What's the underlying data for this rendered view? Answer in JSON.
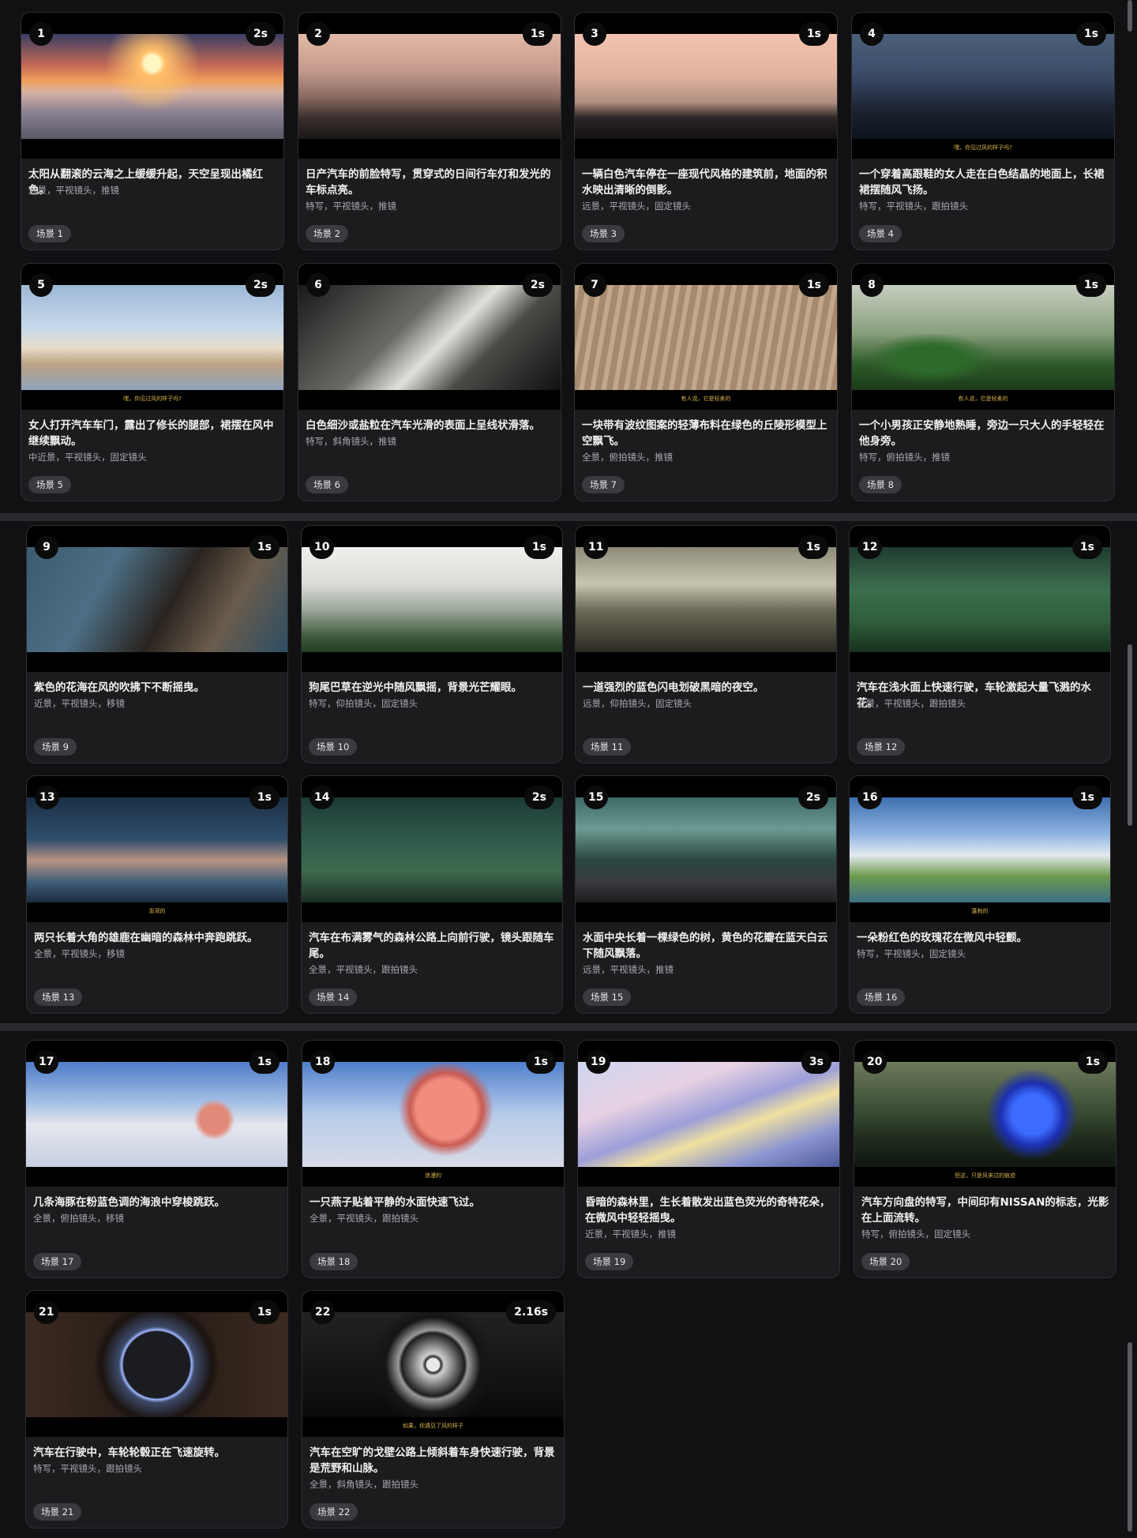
{
  "scene_prefix": "场景",
  "scenes": [
    {
      "n": "1",
      "dur": "2s",
      "desc": "太阳从翻滚的云海之上缓缓升起，天空呈现出橘红色。",
      "tags": "远景，平视镜头，推镜",
      "badge": "场景 1",
      "sub": "",
      "art": "sunrise"
    },
    {
      "n": "2",
      "dur": "1s",
      "desc": "日产汽车的前脸特写，贯穿式的日间行车灯和发光的车标点亮。",
      "tags": "特写，平视镜头，推镜",
      "badge": "场景 2",
      "sub": "",
      "art": "hood"
    },
    {
      "n": "3",
      "dur": "1s",
      "desc": "一辆白色汽车停在一座现代风格的建筑前，地面的积水映出清晰的倒影。",
      "tags": "远景，平视镜头，固定镜头",
      "badge": "场景 3",
      "sub": "",
      "art": "carfront"
    },
    {
      "n": "4",
      "dur": "1s",
      "desc": "一个穿着高跟鞋的女人走在白色结晶的地面上，长裙裙摆随风飞扬。",
      "tags": "特写，平视镜头，跟拍镜头",
      "badge": "场景 4",
      "sub": "嘿，你见过风的样子吗?",
      "art": "building"
    },
    {
      "n": "5",
      "dur": "2s",
      "desc": "女人打开汽车车门，露出了修长的腿部，裙摆在风中继续飘动。",
      "tags": "中近景，平视镜头，固定镜头",
      "badge": "场景 5",
      "sub": "嘿，你见过风的样子吗?",
      "art": "dress"
    },
    {
      "n": "6",
      "dur": "2s",
      "desc": "白色细沙或盐粒在汽车光滑的表面上呈线状滑落。",
      "tags": "特写，斜角镜头，推镜",
      "badge": "场景 6",
      "sub": "",
      "art": "sand"
    },
    {
      "n": "7",
      "dur": "1s",
      "desc": "一块带有波纹图案的轻薄布料在绿色的丘陵形模型上空飘飞。",
      "tags": "全景，俯拍镜头，推镜",
      "badge": "场景 7",
      "sub": "有人说，它是轻柔的",
      "art": "stripes"
    },
    {
      "n": "8",
      "dur": "1s",
      "desc": "一个小男孩正安静地熟睡，旁边一只大人的手轻轻在他身旁。",
      "tags": "特写，俯拍镜头，推镜",
      "badge": "场景 8",
      "sub": "有人说，它是轻柔的",
      "art": "cloth"
    },
    {
      "n": "9",
      "dur": "1s",
      "desc": "紫色的花海在风的吹拂下不断摇曳。",
      "tags": "近景，平视镜头，移镜",
      "badge": "场景 9",
      "sub": "",
      "art": "boy"
    },
    {
      "n": "10",
      "dur": "1s",
      "desc": "狗尾巴草在逆光中随风飘摇，背景光芒耀眼。",
      "tags": "特写，仰拍镜头，固定镜头",
      "badge": "场景 10",
      "sub": "",
      "art": "fog"
    },
    {
      "n": "11",
      "dur": "1s",
      "desc": "一道强烈的蓝色闪电划破黑暗的夜空。",
      "tags": "远景，仰拍镜头，固定镜头",
      "badge": "场景 11",
      "sub": "",
      "art": "grass"
    },
    {
      "n": "12",
      "dur": "1s",
      "desc": "汽车在浅水面上快速行驶，车轮激起大量飞溅的水花。",
      "tags": "全景，平视镜头，跟拍镜头",
      "badge": "场景 12",
      "sub": "",
      "art": "forest"
    },
    {
      "n": "13",
      "dur": "1s",
      "desc": "两只长着大角的雄鹿在幽暗的森林中奔跑跳跃。",
      "tags": "全景，平视镜头，移镜",
      "badge": "场景 13",
      "sub": "澎湃的",
      "art": "splash"
    },
    {
      "n": "14",
      "dur": "2s",
      "desc": "汽车在布满雾气的森林公路上向前行驶，镜头跟随车尾。",
      "tags": "全景，平视镜头，跟拍镜头",
      "badge": "场景 14",
      "sub": "",
      "art": "deer"
    },
    {
      "n": "15",
      "dur": "2s",
      "desc": "水面中央长着一棵绿色的树，黄色的花瓣在蓝天白云下随风飘落。",
      "tags": "远景，平视镜头，推镜",
      "badge": "场景 15",
      "sub": "",
      "art": "road"
    },
    {
      "n": "16",
      "dur": "1s",
      "desc": "一朵粉红色的玫瑰花在微风中轻颤。",
      "tags": "特写，平视镜头，固定镜头",
      "badge": "场景 16",
      "sub": "蓬勃的",
      "art": "tree"
    },
    {
      "n": "17",
      "dur": "1s",
      "desc": "几条海豚在粉蓝色调的海浪中穿梭跳跃。",
      "tags": "全景，俯拍镜头，移镜",
      "badge": "场景 17",
      "sub": "",
      "art": "rose1"
    },
    {
      "n": "18",
      "dur": "1s",
      "desc": "一只燕子贴着平静的水面快速飞过。",
      "tags": "全景，平视镜头，跟拍镜头",
      "badge": "场景 18",
      "sub": "浪漫的",
      "art": "rose2"
    },
    {
      "n": "19",
      "dur": "3s",
      "desc": "昏暗的森林里，生长着散发出蓝色荧光的奇特花朵，在微风中轻轻摇曳。",
      "tags": "近景，平视镜头，推镜",
      "badge": "场景 19",
      "sub": "",
      "art": "dolphin"
    },
    {
      "n": "20",
      "dur": "1s",
      "desc": "汽车方向盘的特写，中间印有NISSAN的标志，光影在上面流转。",
      "tags": "特写，俯拍镜头，固定镜头",
      "badge": "场景 20",
      "sub": "但这，只是风来过的痕迹",
      "art": "blueflower"
    },
    {
      "n": "21",
      "dur": "1s",
      "desc": "汽车在行驶中，车轮轮毂正在飞速旋转。",
      "tags": "特写，平视镜头，跟拍镜头",
      "badge": "场景 21",
      "sub": "",
      "art": "pbutton"
    },
    {
      "n": "22",
      "dur": "2.16s",
      "desc": "汽车在空旷的戈壁公路上倾斜着车身快速行驶，背景是荒野和山脉。",
      "tags": "全景，斜角镜头，跟拍镜头",
      "badge": "场景 22",
      "sub": "如果，你遇见了风的样子",
      "art": "wheel"
    }
  ]
}
